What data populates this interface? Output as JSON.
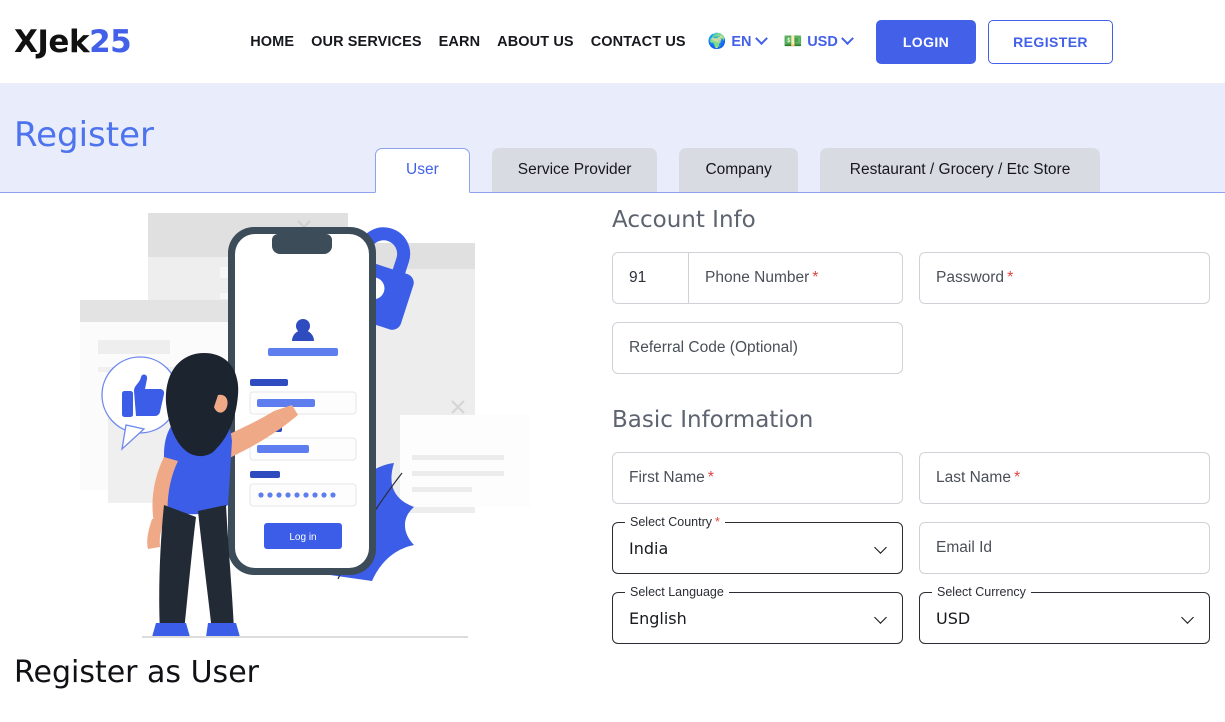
{
  "header": {
    "logo_main": "XJek",
    "logo_accent": "25",
    "nav": [
      {
        "label": "HOME"
      },
      {
        "label": "OUR SERVICES"
      },
      {
        "label": "EARN"
      },
      {
        "label": "ABOUT US"
      },
      {
        "label": "CONTACT US"
      }
    ],
    "language_selector": {
      "emoji": "🌍",
      "label": "EN",
      "icon": "chevron-down-icon"
    },
    "currency_selector": {
      "emoji": "💵",
      "label": "USD",
      "icon": "chevron-down-icon"
    },
    "login_label": "LOGIN",
    "register_label": "REGISTER",
    "accent_color": "#4361e8"
  },
  "banner": {
    "title": "Register",
    "background": "#e9edfb",
    "title_color": "#4e73ee",
    "tabs": [
      {
        "label": "User",
        "active": true
      },
      {
        "label": "Service Provider",
        "active": false
      },
      {
        "label": "Company",
        "active": false
      },
      {
        "label": "Restaurant / Grocery / Etc Store",
        "active": false
      }
    ]
  },
  "left": {
    "heading": "Register as User",
    "illustration": {
      "name": "register-illustration",
      "phone_login_button": "Log in",
      "password_dots": "•••••••••"
    }
  },
  "form": {
    "account_info_title": "Account Info",
    "basic_information_title": "Basic Information",
    "phone_country_code": "91",
    "phone_placeholder": "Phone Number",
    "password_placeholder": "Password",
    "referral_placeholder": "Referral Code (Optional)",
    "first_name_placeholder": "First Name",
    "last_name_placeholder": "Last Name",
    "email_placeholder": "Email Id",
    "country_label": "Select Country",
    "country_value": "India",
    "language_label": "Select Language",
    "language_value": "English",
    "currency_label": "Select Currency",
    "currency_value": "USD",
    "required_marker": "*",
    "required_color": "#e0453f"
  }
}
